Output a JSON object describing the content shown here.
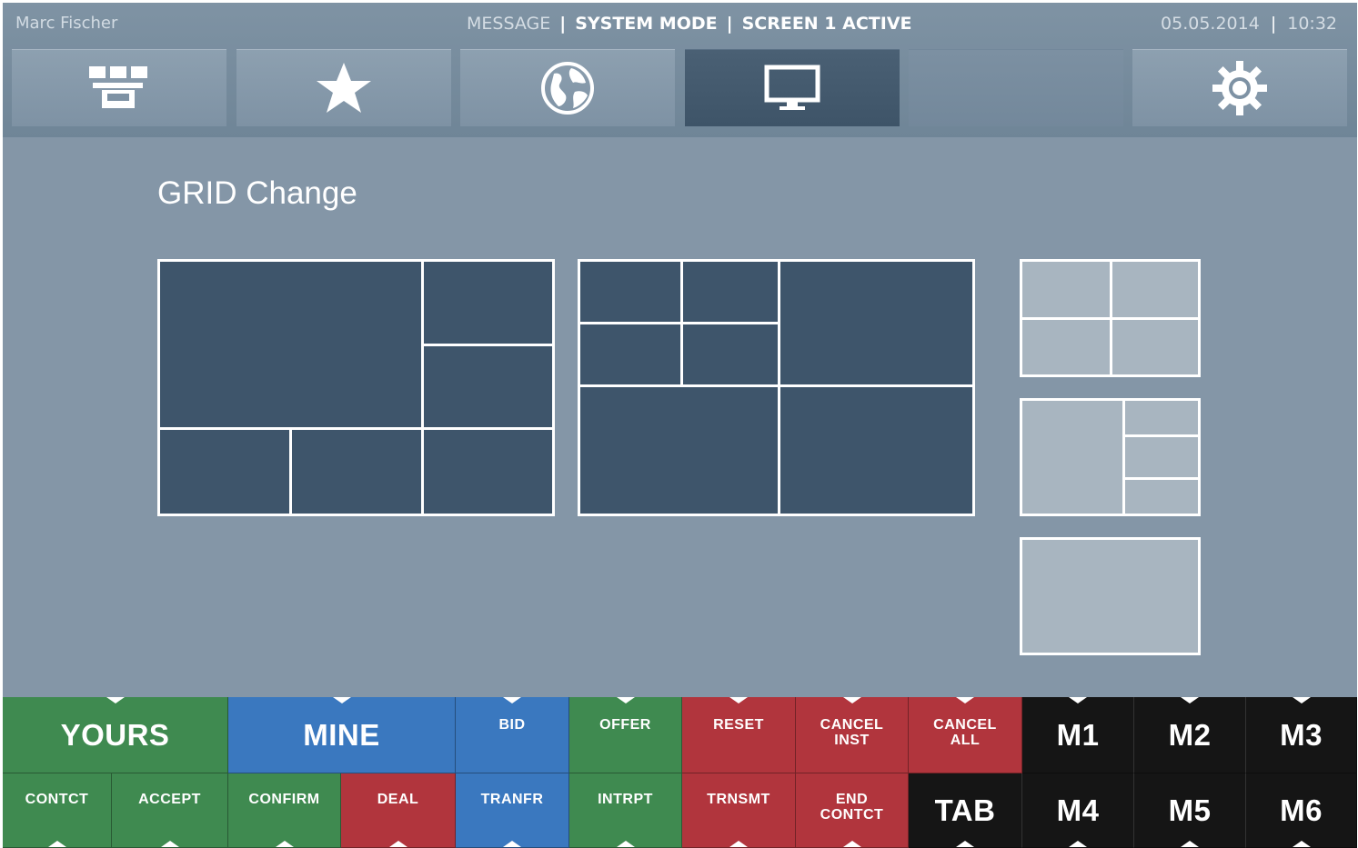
{
  "header": {
    "user": "Marc Fischer",
    "status": {
      "message": "MESSAGE",
      "mode": "SYSTEM MODE",
      "screen": "SCREEN 1 ACTIVE"
    },
    "date": "05.05.2014",
    "time": "10:32"
  },
  "tabs": [
    {
      "icon": "console-icon",
      "active": false
    },
    {
      "icon": "star-icon",
      "active": false
    },
    {
      "icon": "globe-icon",
      "active": false
    },
    {
      "icon": "monitor-icon",
      "active": true
    },
    {
      "icon": "",
      "active": false
    },
    {
      "icon": "gear-icon",
      "active": false
    }
  ],
  "content": {
    "title": "GRID Change"
  },
  "grid_layouts": [
    "layout-6-split",
    "layout-6-quad",
    "thumb-2x2",
    "thumb-1-plus-3",
    "thumb-single"
  ],
  "keys": {
    "row1": [
      "YOURS",
      "MINE",
      "BID",
      "OFFER",
      "RESET",
      "CANCEL INST",
      "CANCEL ALL",
      "M1",
      "M2",
      "M3"
    ],
    "yours": "YOURS",
    "mine": "MINE",
    "bid": "BID",
    "offer": "OFFER",
    "reset": "RESET",
    "cancel_inst_1": "CANCEL",
    "cancel_inst_2": "INST",
    "cancel_all_1": "CANCEL",
    "cancel_all_2": "ALL",
    "m1": "M1",
    "m2": "M2",
    "m3": "M3",
    "contct": "CONTCT",
    "accept": "ACCEPT",
    "confirm": "CONFIRM",
    "deal": "DEAL",
    "tranfr": "TRANFR",
    "intrpt": "INTRPT",
    "trnsmt": "TRNSMT",
    "end_contct_1": "END",
    "end_contct_2": "CONTCT",
    "tab": "TAB",
    "m4": "M4",
    "m5": "M5",
    "m6": "M6"
  },
  "colors": {
    "background": "#8496a7",
    "panel_dark": "#3e556b",
    "thumb": "#a8b5c0",
    "green": "#3f8a50",
    "blue": "#3a78bf",
    "red": "#b1353d",
    "black": "#151515"
  }
}
